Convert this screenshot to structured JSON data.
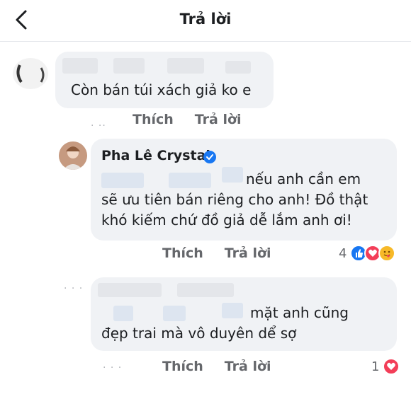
{
  "header": {
    "title": "Trả lời"
  },
  "comment1": {
    "text": "Còn bán túi xách giả ko e",
    "like": "Thích",
    "reply": "Trả lời"
  },
  "reply1": {
    "author": "Pha Lê Crystal",
    "line1": "nếu anh cần em",
    "line2": "sẽ ưu tiên bán riêng cho anh! Đồ thật",
    "line3": "khó kiếm chứ đồ giả dễ lắm anh ơi!",
    "like": "Thích",
    "reply": "Trả lời",
    "reaction_count": "4"
  },
  "reply2": {
    "line1": "mặt anh cũng",
    "line2": "đẹp trai mà vô duyên dể sợ",
    "like": "Thích",
    "reply": "Trả lời",
    "reaction_count": "1"
  },
  "colors": {
    "like_blue": "#1877f2",
    "love_red": "#f33e58",
    "haha_yellow": "#f7b928"
  }
}
